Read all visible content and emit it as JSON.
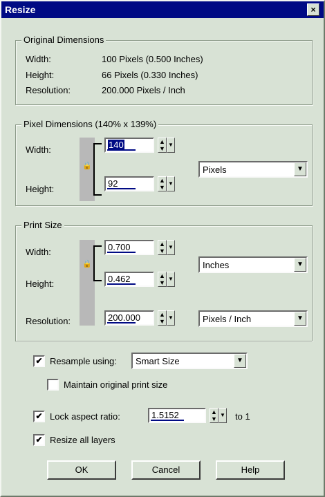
{
  "window": {
    "title": "Resize",
    "close_label": "×"
  },
  "original": {
    "group_label": "Original Dimensions",
    "width_label": "Width:",
    "width_value": "100 Pixels (0.500 Inches)",
    "height_label": "Height:",
    "height_value": "66 Pixels (0.330 Inches)",
    "resolution_label": "Resolution:",
    "resolution_value": "200.000 Pixels / Inch"
  },
  "pixel_dims": {
    "group_label": "Pixel Dimensions (140% x 139%)",
    "width_label": "Width:",
    "width_value": "140",
    "height_label": "Height:",
    "height_value": "92",
    "unit": "Pixels"
  },
  "print_size": {
    "group_label": "Print Size",
    "width_label": "Width:",
    "width_value": "0.700",
    "height_label": "Height:",
    "height_value": "0.462",
    "unit": "Inches",
    "resolution_label": "Resolution:",
    "resolution_value": "200.000",
    "resolution_unit": "Pixels / Inch"
  },
  "options": {
    "resample_label": "Resample using:",
    "resample_checked": "✔",
    "resample_method": "Smart Size",
    "maintain_label": "Maintain original print size",
    "maintain_checked": "",
    "lock_label": "Lock aspect ratio:",
    "lock_checked": "✔",
    "lock_value": "1.5152",
    "lock_suffix": "to 1",
    "layers_label": "Resize all layers",
    "layers_checked": "✔"
  },
  "buttons": {
    "ok": "OK",
    "cancel": "Cancel",
    "help": "Help"
  },
  "icons": {
    "spinner": "spinner-arrows-icon",
    "dropdown": "chevron-down-icon",
    "lock": "lock-icon"
  }
}
